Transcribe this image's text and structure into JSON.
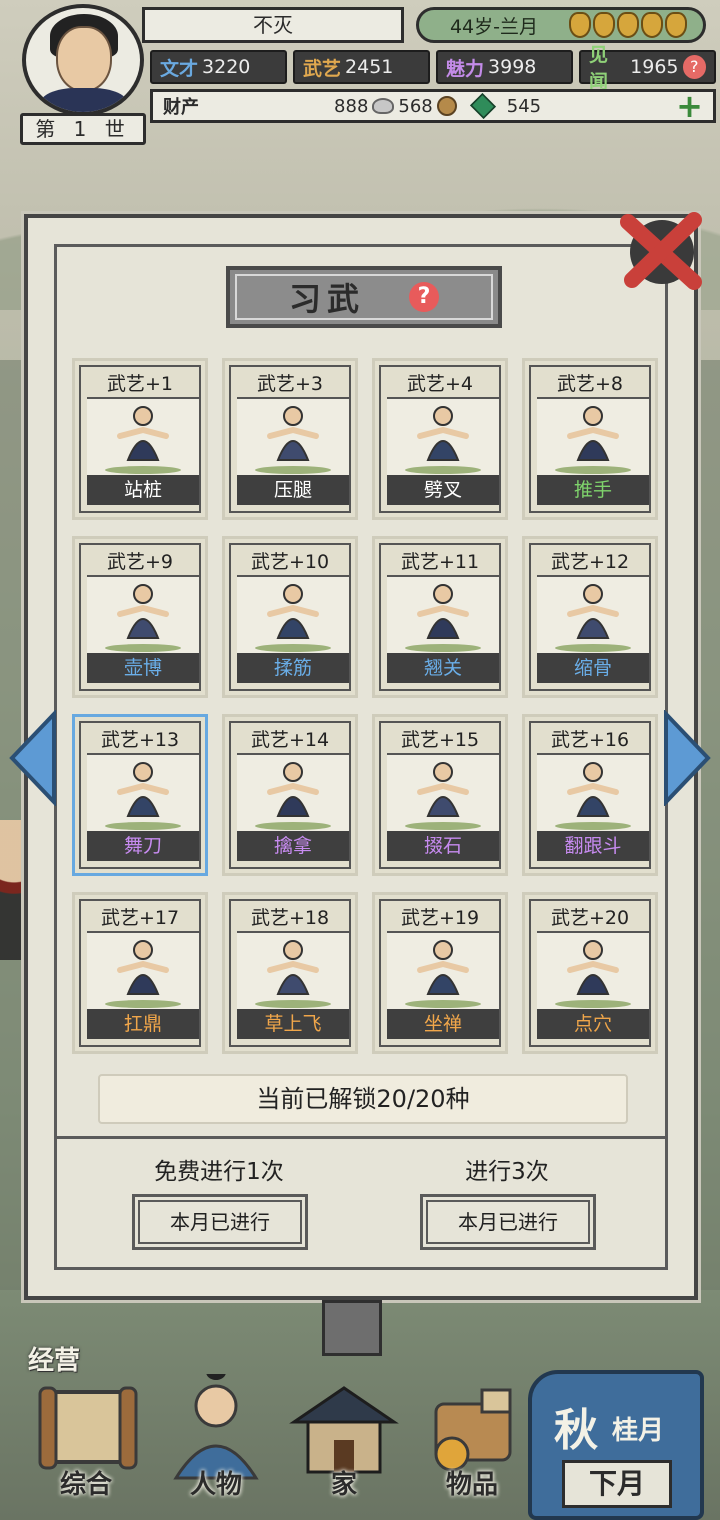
{
  "hud": {
    "generation": "第 1 世",
    "name": "不灭",
    "age": "44岁-兰月",
    "stats": [
      {
        "label": "文才",
        "value": "3220"
      },
      {
        "label": "武艺",
        "value": "2451"
      },
      {
        "label": "魅力",
        "value": "3998"
      },
      {
        "label": "见闻",
        "value": "1965"
      }
    ],
    "wealth_label": "财产",
    "silver": "888",
    "copper": "568",
    "jade": "545"
  },
  "panel": {
    "title": "习武",
    "unlock_status": "当前已解锁20/20种",
    "free_label": "免费进行1次",
    "paid_label": "进行3次",
    "free_button": "本月已进行",
    "paid_button": "本月已进行"
  },
  "exercises": [
    {
      "gain": "武艺+1",
      "name": "站桩",
      "color": "#ffffff"
    },
    {
      "gain": "武艺+3",
      "name": "压腿",
      "color": "#ffffff"
    },
    {
      "gain": "武艺+4",
      "name": "劈叉",
      "color": "#ffffff"
    },
    {
      "gain": "武艺+8",
      "name": "推手",
      "color": "#7fd36c"
    },
    {
      "gain": "武艺+9",
      "name": "壶博",
      "color": "#6aaee8"
    },
    {
      "gain": "武艺+10",
      "name": "揉筋",
      "color": "#6aaee8"
    },
    {
      "gain": "武艺+11",
      "name": "翘关",
      "color": "#6aaee8"
    },
    {
      "gain": "武艺+12",
      "name": "缩骨",
      "color": "#6aaee8"
    },
    {
      "gain": "武艺+13",
      "name": "舞刀",
      "color": "#c78bf0"
    },
    {
      "gain": "武艺+14",
      "name": "擒拿",
      "color": "#c78bf0"
    },
    {
      "gain": "武艺+15",
      "name": "掇石",
      "color": "#c78bf0"
    },
    {
      "gain": "武艺+16",
      "name": "翻跟斗",
      "color": "#c78bf0"
    },
    {
      "gain": "武艺+17",
      "name": "扛鼎",
      "color": "#f0a64a"
    },
    {
      "gain": "武艺+18",
      "name": "草上飞",
      "color": "#f0a64a"
    },
    {
      "gain": "武艺+19",
      "name": "坐禅",
      "color": "#f0a64a"
    },
    {
      "gain": "武艺+20",
      "name": "点穴",
      "color": "#f0a64a"
    }
  ],
  "bottom": {
    "jingying": "经营",
    "nav": [
      "综合",
      "人物",
      "家",
      "物品"
    ],
    "season": "秋",
    "month": "桂月",
    "next_month": "下月"
  },
  "colors": {
    "accent_blue": "#67a8e0",
    "panel_bg": "#e6e4d8"
  }
}
